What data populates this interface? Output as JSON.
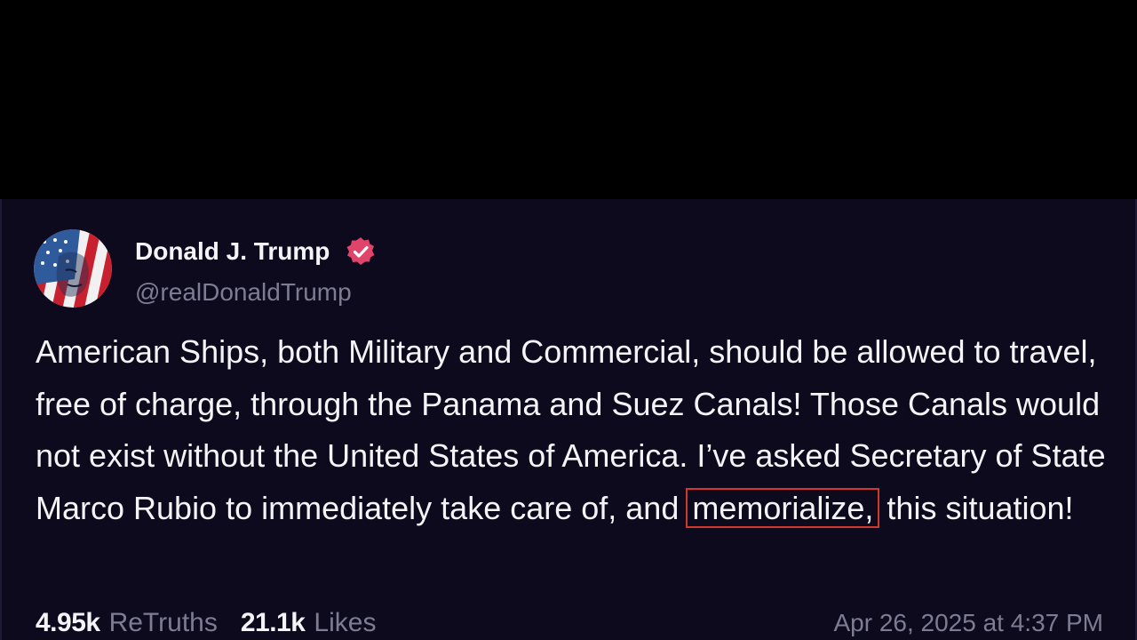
{
  "author": {
    "display_name": "Donald J. Trump",
    "handle": "@realDonaldTrump",
    "verified_icon": "verified-badge-icon",
    "verified_color": "#e0446a",
    "avatar_icon": "avatar-flag-portrait"
  },
  "post": {
    "text_before": "American Ships, both Military and Commercial, should be allowed to travel, free of charge, through the Panama and Suez Canals! Those Canals would not exist without the United States of America. I’ve asked Secretary of State Marco Rubio to immediately take care of, and",
    "highlighted": "memorialize,",
    "text_after": "this situation!",
    "highlight_color": "#d2372e"
  },
  "stats": {
    "retruths_count": "4.95k",
    "retruths_label": "ReTruths",
    "likes_count": "21.1k",
    "likes_label": "Likes"
  },
  "timestamp": "Apr 26, 2025 at 4:37 PM",
  "colors": {
    "background_top": "#000000",
    "card_background": "#0c0a1c",
    "primary_text": "#f4f4f7",
    "secondary_text": "#7e7c95"
  }
}
